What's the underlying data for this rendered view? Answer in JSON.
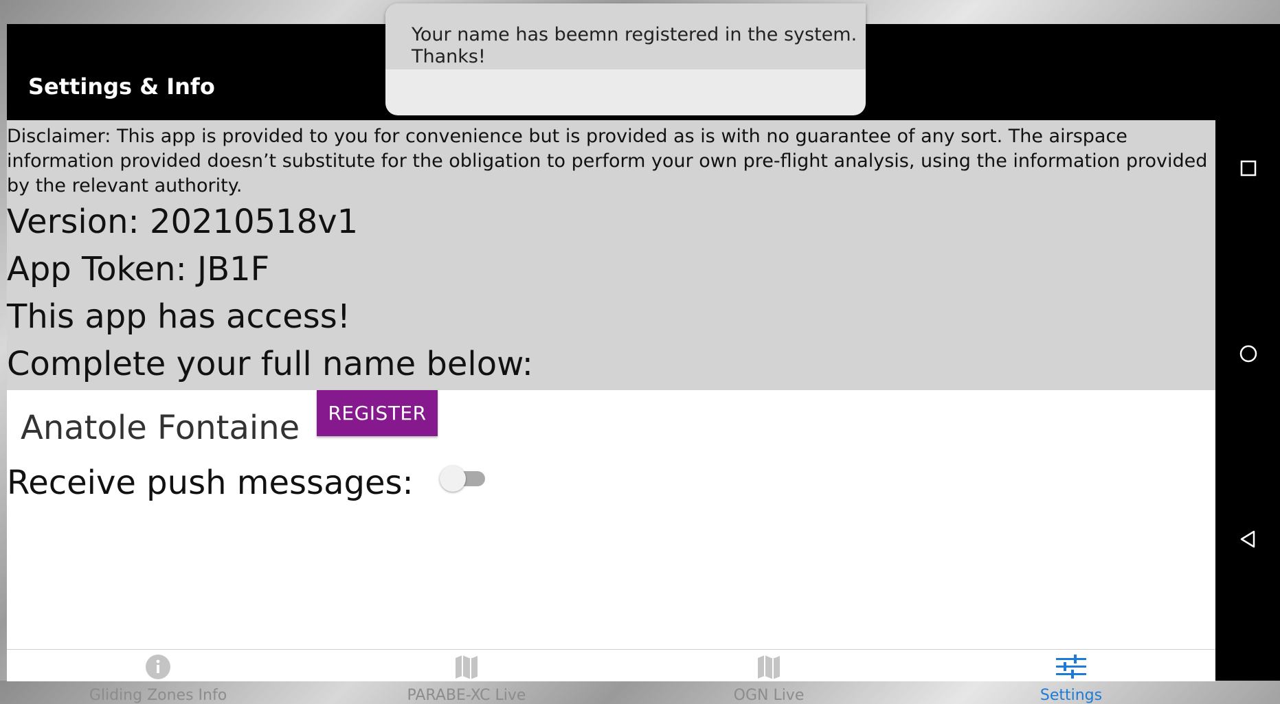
{
  "header": {
    "title": "Settings & Info"
  },
  "toast": {
    "message": "Your name has beemn registered in the system. Thanks!"
  },
  "settings": {
    "disclaimer": " Disclaimer: This app is provided to you for convenience but is provided as is with no guarantee of any sort. The airspace information provided doesn’t substitute for the obligation to perform your own pre-flight analysis, using the information provided by the relevant authority.",
    "version": "Version: 20210518v1",
    "token": "App Token: JB1F",
    "access": "This app has access!",
    "name_prompt": "Complete your full name below:",
    "name_value": "Anatole Fontaine",
    "register_label": "REGISTER",
    "push_label": "Receive push messages:",
    "push_enabled": false
  },
  "tabs": [
    {
      "label": "Gliding Zones Info",
      "icon": "info-icon",
      "active": false
    },
    {
      "label": "PARABE-XC Live",
      "icon": "map-icon",
      "active": false
    },
    {
      "label": "OGN Live",
      "icon": "map-icon",
      "active": false
    },
    {
      "label": "Settings",
      "icon": "sliders-icon",
      "active": true
    }
  ],
  "navbar": {
    "buttons": [
      "recents-icon",
      "home-icon",
      "back-icon"
    ]
  },
  "colors": {
    "accent": "#86198e",
    "active_tab": "#1c7bd8",
    "inactive_tab": "#8c8c8c",
    "panel": "#d3d3d3"
  }
}
